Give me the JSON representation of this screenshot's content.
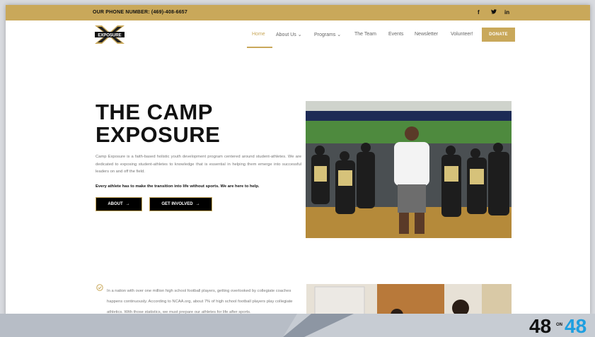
{
  "topbar": {
    "phone": "OUR PHONE NUMBER: (469)-408-6657",
    "social": [
      "f",
      "𝒇",
      "in"
    ]
  },
  "logo": {
    "text": "EXPOSURE"
  },
  "nav": {
    "items": [
      {
        "label": "Home"
      },
      {
        "label": "About Us"
      },
      {
        "label": "Programs"
      },
      {
        "label": "The Team"
      },
      {
        "label": "Events"
      },
      {
        "label": "Newsletter"
      },
      {
        "label": "Volunteer!"
      }
    ],
    "caret": "⌄",
    "donate": "DONATE"
  },
  "hero": {
    "title_line1": "THE CAMP",
    "title_line2": "EXPOSURE",
    "description": "Camp Exposure is a faith-based holistic youth development program centered around student-athletes. We are dedicated to exposing student-athletes to knowledge that is essential in helping them emerge into successful leaders on and off the field.",
    "tagline": "Every athlete has to make the transition into life without sports. We are here to help.",
    "about_btn": "ABOUT",
    "involved_btn": "GET INVOLVED",
    "arrow": "→"
  },
  "section2": {
    "text": "In a nation with over one million high school football players, getting overlooked by collegiate coaches happens continuously. According to NCAA.org, about 7% of high school football players play collegiate athletics. With those statistics, we must prepare our athletes for life after sports."
  },
  "brand": {
    "left": "48",
    "middle": "ON",
    "right": "48"
  },
  "colors": {
    "gold": "#c9a85a",
    "black": "#000000",
    "brand_blue": "#1e9fe0"
  }
}
